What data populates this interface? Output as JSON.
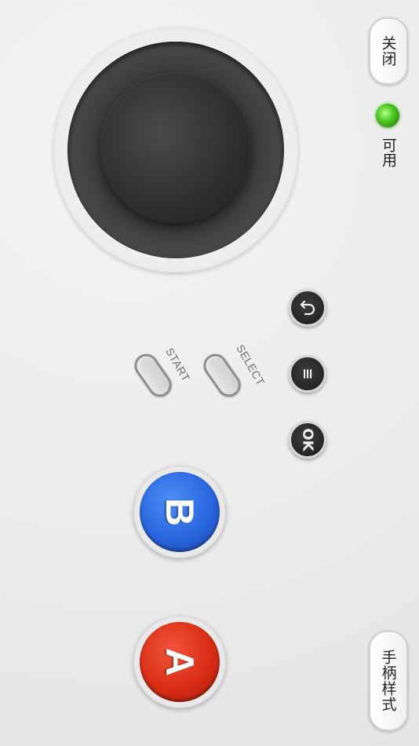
{
  "top_button": {
    "label": "关闭"
  },
  "status": {
    "label": "可用",
    "led_color": "#4ecb21"
  },
  "bottom_button": {
    "label": "手柄样式"
  },
  "small_buttons": {
    "back_icon": "undo-arrow-icon",
    "menu_glyph": "≡",
    "ok_label": "OK"
  },
  "capsules": {
    "start_label": "START",
    "select_label": "SELECT"
  },
  "big_buttons": {
    "b_label": "B",
    "a_label": "A",
    "b_color": "#2a66de",
    "a_color": "#d92d16"
  }
}
